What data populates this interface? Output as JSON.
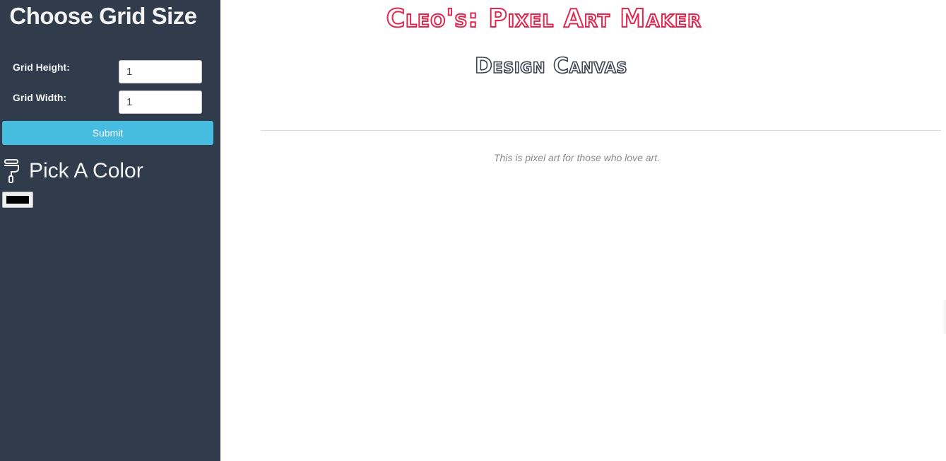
{
  "sidebar": {
    "title": "Choose Grid Size",
    "height_label": "Grid Height:",
    "height_value": "1",
    "width_label": "Grid Width:",
    "width_value": "1",
    "submit_label": "Submit",
    "color_heading": "Pick A Color",
    "color_heading_icon": "paint-roller-icon",
    "picked_color": "#000000"
  },
  "main": {
    "title": "Cleo's: Pixel Art Maker",
    "subtitle": "Design Canvas",
    "tagline": "This is pixel art for those who love art.",
    "title_color": "#e0284f",
    "subtitle_color": "#3d4350"
  },
  "colors": {
    "sidebar_bg": "#303c4b",
    "submit_bg": "#46bce1"
  }
}
